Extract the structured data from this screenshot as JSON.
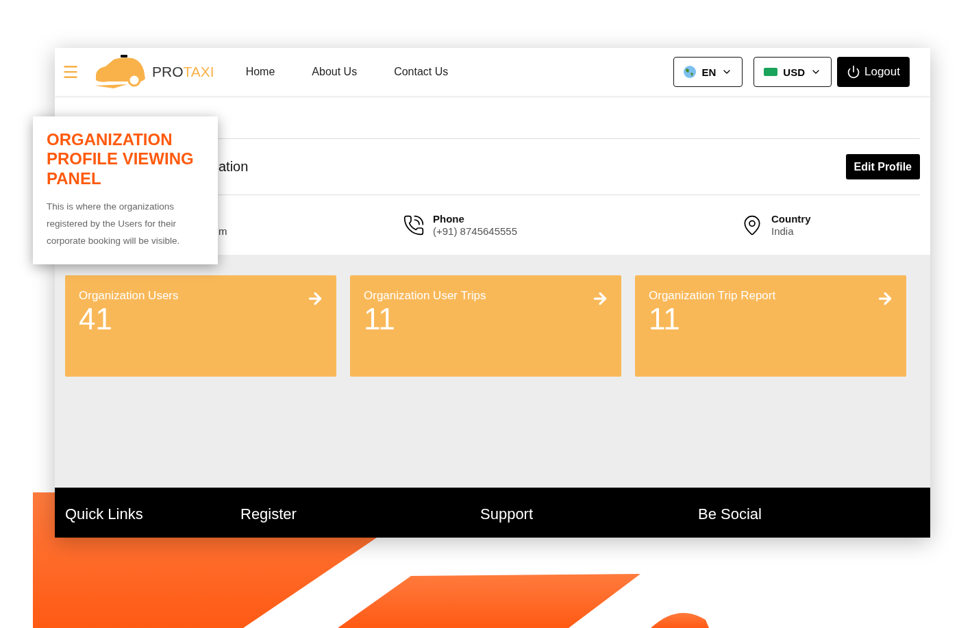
{
  "header": {
    "brand_prefix": "PRO",
    "brand_suffix": "TAXI",
    "nav": [
      {
        "label": "Home",
        "selected": false
      },
      {
        "label": "About Us",
        "selected": false
      },
      {
        "label": "Contact Us",
        "selected": false
      }
    ],
    "language": "EN",
    "currency": "USD",
    "logout": "Logout"
  },
  "profile": {
    "section_title": "ation",
    "edit_button": "Edit Profile",
    "details": [
      {
        "kind": "email",
        "value": "m"
      },
      {
        "kind": "phone",
        "label": "Phone",
        "value": "(+91) 8745645555"
      },
      {
        "kind": "location",
        "label": "Country",
        "value": "India"
      }
    ]
  },
  "cards": [
    {
      "title": "Organization Users",
      "count": "41"
    },
    {
      "title": "Organization User Trips",
      "count": "11"
    },
    {
      "title": "Organization Trip Report",
      "count": "11"
    }
  ],
  "footer": {
    "headings": [
      "Quick Links",
      "Register",
      "Support",
      "Be Social"
    ]
  },
  "callout": {
    "title": "ORGANIZATION PROFILE VIEWING PANEL",
    "text": "This is where the organizations registered by the Users for their corporate booking will be visible."
  }
}
